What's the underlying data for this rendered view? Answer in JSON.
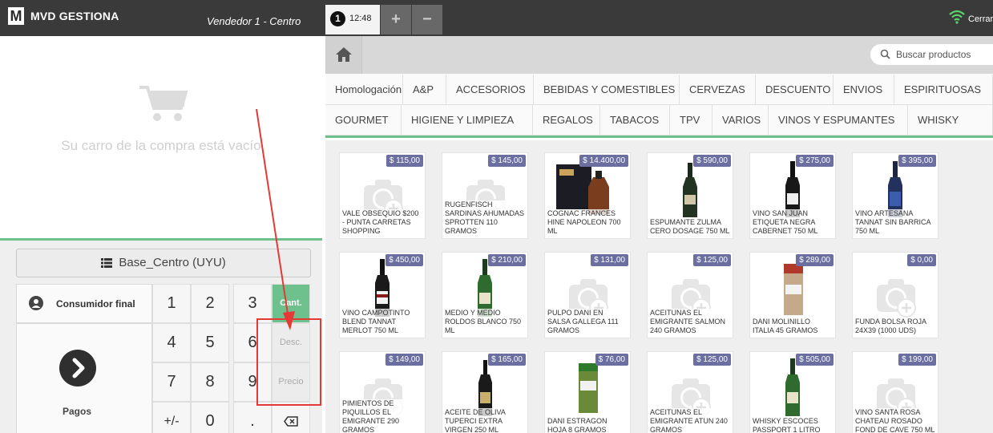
{
  "header": {
    "logo_letter": "M",
    "app_name": "MVD GESTIONA",
    "seller": "Vendedor 1 - Centro",
    "order_number": "1",
    "order_time": "12:48",
    "add_order": "+",
    "remove_order": "−",
    "close": "Cerrar"
  },
  "cart": {
    "empty_message": "Su carro de la compra está vacío"
  },
  "pricelist": {
    "label": "Base_Centro (UYU)"
  },
  "customer": {
    "label": "Consumidor final"
  },
  "payment": {
    "label": "Pagos"
  },
  "numpad": {
    "keys": [
      "1",
      "2",
      "3",
      "4",
      "5",
      "6",
      "7",
      "8",
      "9",
      "+/-",
      "0",
      "."
    ],
    "modes": [
      "Cant.",
      "Desc.",
      "Precio"
    ]
  },
  "search": {
    "placeholder": "Buscar productos"
  },
  "categories": {
    "row1": [
      "Homologación",
      "A&P",
      "ACCESORIOS",
      "BEBIDAS Y COMESTIBLES",
      "CERVEZAS",
      "DESCUENTO",
      "ENVIOS",
      "ESPIRITUOSAS"
    ],
    "row2": [
      "GOURMET",
      "HIGIENE Y LIMPIEZA",
      "REGALOS",
      "TABACOS",
      "TPV",
      "VARIOS",
      "VINOS Y ESPUMANTES",
      "WHISKY"
    ]
  },
  "products": [
    {
      "name": "VALE OBSEQUIO $200 - PUNTA CARRETAS SHOPPING",
      "price": "$ 115,00",
      "img": "placeholder"
    },
    {
      "name": "RUGENFISCH SARDINAS AHUMADAS SPROTTEN 110 GRAMOS",
      "price": "$ 145,00",
      "img": "placeholder"
    },
    {
      "name": "COGNAC FRANCES HINE NAPOLEON 700 ML",
      "price": "$ 14.400,00",
      "img": "box"
    },
    {
      "name": "ESPUMANTE ZULMA CERO DOSAGE 750 ML",
      "price": "$ 590,00",
      "img": "bottle-sparkling"
    },
    {
      "name": "VINO SAN JUAN ETIQUETA NEGRA CABERNET 750 ML",
      "price": "$ 275,00",
      "img": "bottle-dark"
    },
    {
      "name": "VINO ARTESANA TANNAT SIN BARRICA 750 ML",
      "price": "$ 395,00",
      "img": "bottle-blue"
    },
    {
      "name": "VINO CAMPOTINTO BLEND TANNAT MERLOT 750 ML",
      "price": "$ 450,00",
      "img": "bottle-red"
    },
    {
      "name": "MEDIO Y MEDIO ROLDOS BLANCO 750 ML",
      "price": "$ 210,00",
      "img": "bottle-green"
    },
    {
      "name": "PULPO DANI EN SALSA GALLEGA 111 GRAMOS",
      "price": "$ 131,00",
      "img": "placeholder"
    },
    {
      "name": "ACEITUNAS EL EMIGRANTE SALMON 240 GRAMOS",
      "price": "$ 125,00",
      "img": "placeholder"
    },
    {
      "name": "DANI MOLINILLO ITALIA 45 GRAMOS",
      "price": "$ 289,00",
      "img": "jar"
    },
    {
      "name": "FUNDA BOLSA ROJA 24x39 (1000 UDS)",
      "price": "$ 0,00",
      "img": "placeholder"
    },
    {
      "name": "PIMIENTOS DE PIQUILLOS EL EMIGRANTE 290 GRAMOS",
      "price": "$ 149,00",
      "img": "placeholder"
    },
    {
      "name": "ACEITE DE OLIVA TUPERCI EXTRA VIRGEN 250 ML",
      "price": "$ 165,00",
      "img": "bottle-olive"
    },
    {
      "name": "DANI ESTRAGON HOJA 8 GRAMOS",
      "price": "$ 76,00",
      "img": "jar-green"
    },
    {
      "name": "ACEITUNAS EL EMIGRANTE ATUN 240 GRAMOS",
      "price": "$ 125,00",
      "img": "placeholder"
    },
    {
      "name": "WHISKY ESCOCES PASSPORT 1 LITRO",
      "price": "$ 505,00",
      "img": "bottle-green"
    },
    {
      "name": "VINO SANTA ROSA CHATEAU ROSADO FOND DE CAVE 750 ML",
      "price": "$ 199,00",
      "img": "placeholder"
    }
  ],
  "colors": {
    "accent": "#6ec18d",
    "topbar": "#3a3a3a",
    "price_badge": "#6a6fa0",
    "annotation": "#e53935"
  }
}
